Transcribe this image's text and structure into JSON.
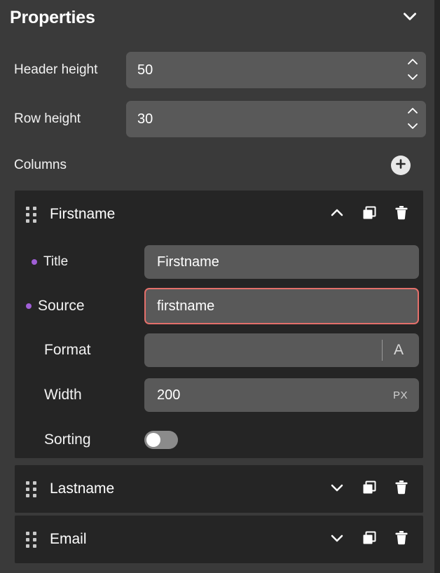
{
  "panel": {
    "title": "Properties",
    "collapse_icon": "chevron-down-icon"
  },
  "settings": [
    {
      "label": "Header height",
      "value": "50"
    },
    {
      "label": "Row height",
      "value": "30"
    }
  ],
  "columns_section": {
    "label": "Columns",
    "add_icon": "plus-icon"
  },
  "columns": [
    {
      "name": "Firstname",
      "expanded": true,
      "toggle_icon": "chevron-up-icon",
      "duplicate_icon": "copy-icon",
      "delete_icon": "trash-icon",
      "drag_icon": "drag-handle-icon",
      "fields": {
        "title": {
          "label": "Title",
          "value": "Firstname",
          "required": true
        },
        "source": {
          "label": "Source",
          "value": "firstname",
          "required": true,
          "error": true
        },
        "format": {
          "label": "Format",
          "value": "",
          "placeholder": "",
          "suffix": "A"
        },
        "width": {
          "label": "Width",
          "value": "200",
          "suffix": "PX"
        },
        "sorting": {
          "label": "Sorting",
          "enabled": false
        }
      }
    },
    {
      "name": "Lastname",
      "expanded": false,
      "toggle_icon": "chevron-down-icon",
      "duplicate_icon": "copy-icon",
      "delete_icon": "trash-icon",
      "drag_icon": "drag-handle-icon"
    },
    {
      "name": "Email",
      "expanded": false,
      "toggle_icon": "chevron-down-icon",
      "duplicate_icon": "copy-icon",
      "delete_icon": "trash-icon",
      "drag_icon": "drag-handle-icon"
    }
  ],
  "colors": {
    "panel_bg": "#3a3a3a",
    "card_bg": "#252525",
    "input_bg": "#595959",
    "accent_required": "#a05fd6",
    "error_border": "#e4706b",
    "text": "#ffffff"
  }
}
